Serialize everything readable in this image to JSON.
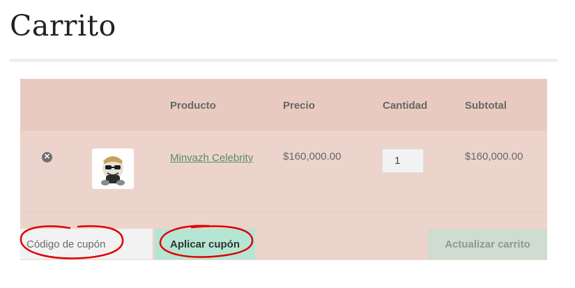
{
  "page": {
    "title": "Carrito"
  },
  "table": {
    "headers": {
      "product": "Producto",
      "price": "Precio",
      "quantity": "Cantidad",
      "subtotal": "Subtotal"
    },
    "rows": [
      {
        "remove_icon": "close-circle-icon",
        "product_name": "Minvazh Celebrity",
        "price": "$160,000.00",
        "quantity": "1",
        "subtotal": "$160,000.00"
      }
    ]
  },
  "actions": {
    "coupon_placeholder": "Código de cupón",
    "apply_coupon_label": "Aplicar cupón",
    "update_cart_label": "Actualizar carrito"
  },
  "colors": {
    "cart_bg": "#ecd4cc",
    "header_bg": "#e9cac1",
    "link": "#5c8a6b",
    "apply_button": "#b4e6d3",
    "update_button_disabled": "#cfdcd0",
    "annotation": "#e00000"
  }
}
